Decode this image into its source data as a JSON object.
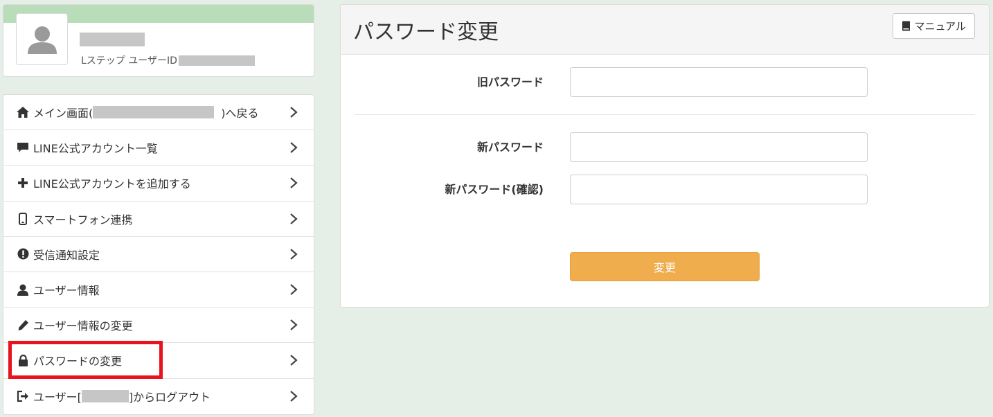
{
  "profile": {
    "user_id_label": "Lステップ ユーザーID"
  },
  "menu": {
    "items": [
      {
        "icon": "home-icon",
        "label_before": "メイン画面(",
        "label_after": ")へ戻る"
      },
      {
        "icon": "comment-icon",
        "label": "LINE公式アカウント一覧"
      },
      {
        "icon": "plus-icon",
        "label": "LINE公式アカウントを追加する"
      },
      {
        "icon": "phone-icon",
        "label": "スマートフォン連携"
      },
      {
        "icon": "exclamation-circle-icon",
        "label": "受信通知設定"
      },
      {
        "icon": "user-icon",
        "label": "ユーザー情報"
      },
      {
        "icon": "pencil-icon",
        "label": "ユーザー情報の変更"
      },
      {
        "icon": "lock-icon",
        "label": "パスワードの変更"
      },
      {
        "icon": "logout-icon",
        "label_before": "ユーザー[",
        "label_after": "]からログアウト"
      }
    ]
  },
  "panel": {
    "title": "パスワード変更",
    "manual_label": "マニュアル",
    "fields": {
      "old_password_label": "旧パスワード",
      "new_password_label": "新パスワード",
      "confirm_password_label": "新パスワード(確認)"
    },
    "submit_label": "変更"
  },
  "colors": {
    "background": "#e6eee8",
    "profile_band": "#b9dcb9",
    "submit_button": "#f0ad4e",
    "highlight": "#e8131e"
  }
}
